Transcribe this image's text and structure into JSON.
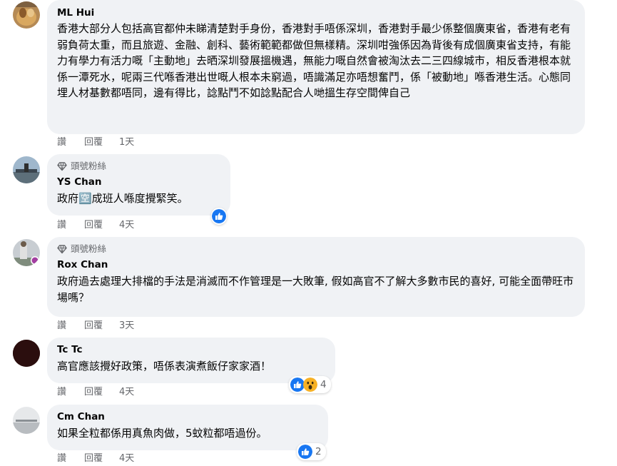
{
  "comments": [
    {
      "name": "ML Hui",
      "badge": "",
      "text": "香港大部分人包括高官都仲未睇清楚對手身份，香港對手唔係深圳，香港對手最少係整個廣東省，香港有老有弱負荷太重，而且旅遊、金融、創科、藝術範範都做但無樣精。深圳咁強係因為背後有成個廣東省支持，有能力有學力有活力嘅「主動地」去晒深圳發展搵機遇，無能力嘅自然會被淘汰去二三四線城市，相反香港根本就係一潭死水，呢兩三代喺香港出世嘅人根本未窮過，唔識滿足亦唔想奮鬥，係「被動地」喺香港生活。心態同埋人材基數都唔同，邊有得比，諗點鬥不如諗點配合人哋搵生存空間俾自己",
      "like": "讚",
      "reply": "回覆",
      "time": "1天",
      "reaction_count": ""
    },
    {
      "name": "YS Chan",
      "badge": "頭號粉絲",
      "text": "政府🈳成班人喺度攪緊笑。",
      "like": "讚",
      "reply": "回覆",
      "time": "4天",
      "reaction_count": ""
    },
    {
      "name": "Rox Chan",
      "badge": "頭號粉絲",
      "text": "政府過去處理大排檔的手法是消滅而不作管理是一大敗筆, 假如高官不了解大多數市民的喜好, 可能全面帶旺市場嗎？",
      "like": "讚",
      "reply": "回覆",
      "time": "3天",
      "reaction_count": ""
    },
    {
      "name": "Tc Tc",
      "badge": "",
      "text": "高官應該攪好政策，唔係表演煮飯仔家家酒！",
      "like": "讚",
      "reply": "回覆",
      "time": "4天",
      "reaction_count": "4"
    },
    {
      "name": "Cm Chan",
      "badge": "",
      "text": "如果全粒都係用真魚肉做，5蚊粒都唔過份。",
      "like": "讚",
      "reply": "回覆",
      "time": "4天",
      "reaction_count": "2"
    }
  ],
  "colors": {
    "bubble": "#f0f2f5",
    "secondary_text": "#65676b",
    "like_blue": "#1877f2",
    "wow_yellow": "#f7b125"
  },
  "icons": {
    "badge": "diamond-icon",
    "like_reaction": "like-reaction-icon",
    "wow_reaction": "wow-reaction-icon"
  }
}
